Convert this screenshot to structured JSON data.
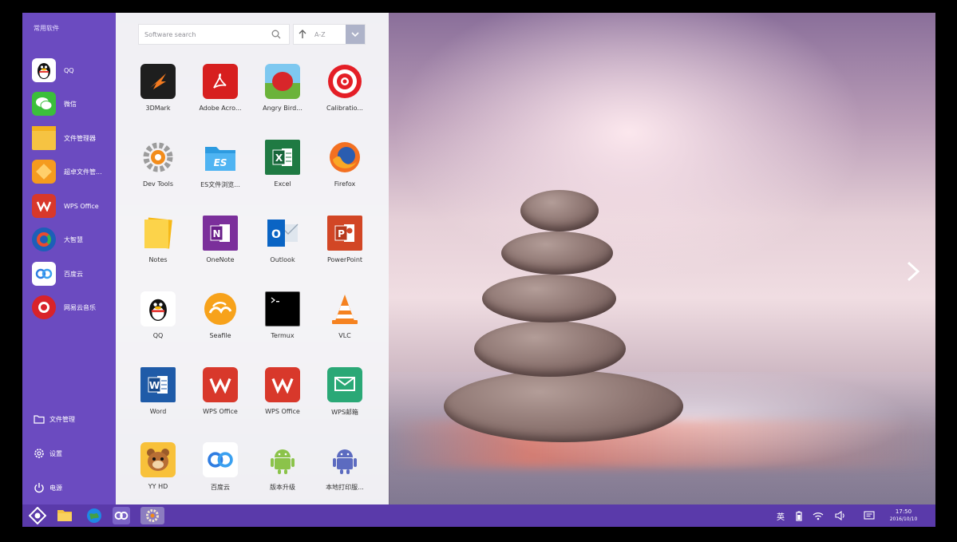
{
  "left_panel": {
    "title": "常用软件",
    "favorites": [
      {
        "label": "QQ",
        "icon": "qq-penguin-icon"
      },
      {
        "label": "微信",
        "icon": "wechat-icon"
      },
      {
        "label": "文件管理器",
        "icon": "folder-icon"
      },
      {
        "label": "超卓文件管...",
        "icon": "file-manager-orange-icon"
      },
      {
        "label": "WPS Office",
        "icon": "wps-icon"
      },
      {
        "label": "大智慧",
        "icon": "dazhihui-icon"
      },
      {
        "label": "百度云",
        "icon": "baidu-cloud-icon"
      },
      {
        "label": "网易云音乐",
        "icon": "netease-music-icon"
      }
    ],
    "system": [
      {
        "label": "文件管理",
        "icon": "folder-outline-icon"
      },
      {
        "label": "设置",
        "icon": "gear-icon"
      },
      {
        "label": "电源",
        "icon": "power-icon"
      }
    ]
  },
  "drawer": {
    "search_placeholder": "Software search",
    "sort_label": "A-Z",
    "apps": [
      {
        "label": "3DMark",
        "icon": "3dmark-icon"
      },
      {
        "label": "Adobe Acro...",
        "icon": "adobe-acrobat-icon"
      },
      {
        "label": "Angry Bird...",
        "icon": "angry-birds-icon"
      },
      {
        "label": "Calibratio...",
        "icon": "target-icon"
      },
      {
        "label": "Dev Tools",
        "icon": "dev-tools-gear-icon"
      },
      {
        "label": "ES文件浏览...",
        "icon": "es-file-explorer-icon"
      },
      {
        "label": "Excel",
        "icon": "excel-icon"
      },
      {
        "label": "Firefox",
        "icon": "firefox-icon"
      },
      {
        "label": "Notes",
        "icon": "notes-icon"
      },
      {
        "label": "OneNote",
        "icon": "onenote-icon"
      },
      {
        "label": "Outlook",
        "icon": "outlook-icon"
      },
      {
        "label": "PowerPoint",
        "icon": "powerpoint-icon"
      },
      {
        "label": "QQ",
        "icon": "qq-penguin-icon"
      },
      {
        "label": "Seafile",
        "icon": "seafile-icon"
      },
      {
        "label": "Termux",
        "icon": "terminal-icon"
      },
      {
        "label": "VLC",
        "icon": "vlc-cone-icon"
      },
      {
        "label": "Word",
        "icon": "word-icon"
      },
      {
        "label": "WPS Office",
        "icon": "wps-icon"
      },
      {
        "label": "WPS Office",
        "icon": "wps-pro-icon"
      },
      {
        "label": "WPS邮箱",
        "icon": "wps-mail-icon"
      },
      {
        "label": "YY HD",
        "icon": "yy-bear-icon"
      },
      {
        "label": "百度云",
        "icon": "baidu-cloud-icon"
      },
      {
        "label": "版本升级",
        "icon": "android-update-icon"
      },
      {
        "label": "本地打印服...",
        "icon": "android-print-icon"
      }
    ]
  },
  "taskbar": {
    "pinned": [
      "start-icon",
      "folder-icon",
      "browser-globe-icon",
      "baidu-cloud-icon",
      "settings-gear-icon"
    ],
    "tray": {
      "ime": "英",
      "time": "17:50",
      "date": "2016/10/10"
    }
  },
  "colors": {
    "panel": "#6b4bc0",
    "taskbar": "#5a3aaa",
    "drawer": "#f4f4f7"
  }
}
